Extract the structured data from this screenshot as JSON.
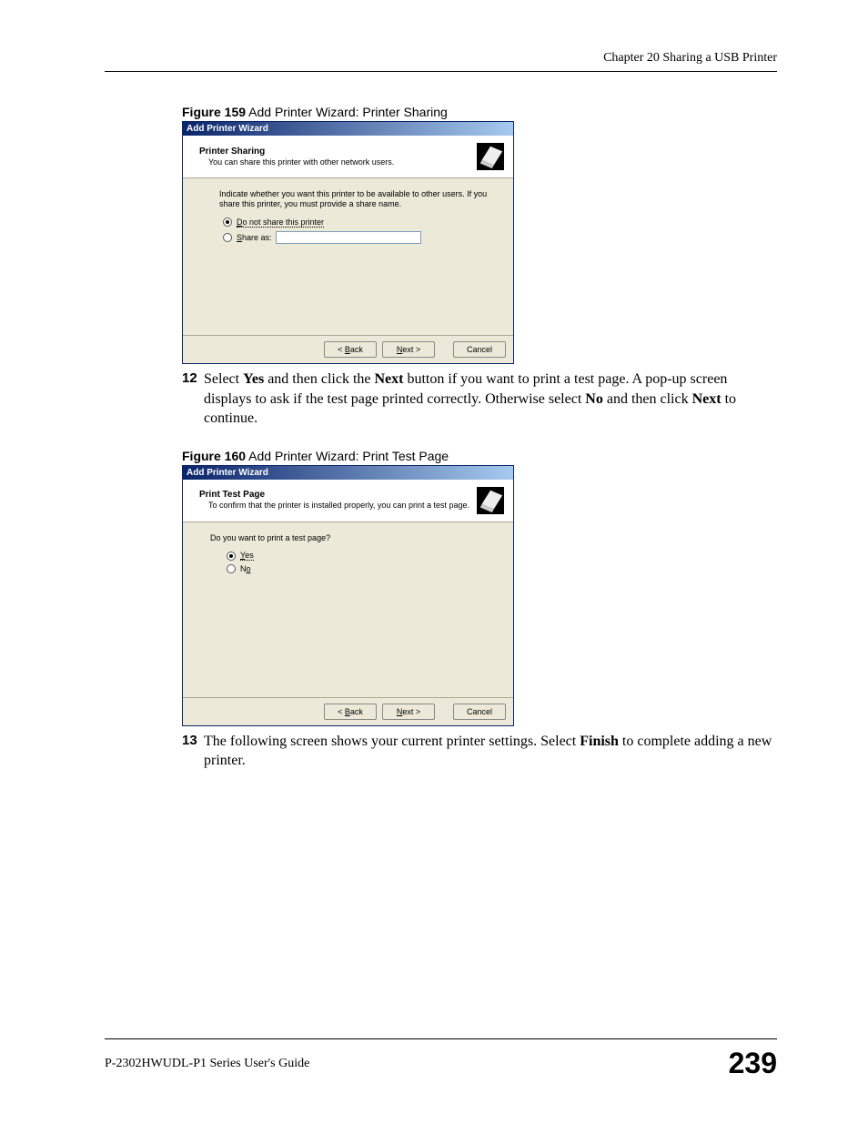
{
  "header": {
    "chapter": "Chapter 20 Sharing a USB Printer"
  },
  "figure159": {
    "caption_bold": "Figure 159",
    "caption_rest": "   Add Printer Wizard: Printer Sharing",
    "window_title": "Add Printer Wizard",
    "panel_title": "Printer Sharing",
    "panel_subtitle": "You can share this printer with other network users.",
    "instruction": "Indicate whether you want this printer to be available to other users. If you share this printer, you must provide a share name.",
    "radio1": "Do not share this printer",
    "radio2": "Share as:",
    "btn_back": "< Back",
    "btn_next": "Next >",
    "btn_cancel": "Cancel"
  },
  "step12": {
    "num": "12",
    "text_pre": "Select ",
    "yes": "Yes",
    "text_mid1": " and then click the ",
    "next": "Next",
    "text_mid2": " button if you want to print a test page. A pop-up screen displays to ask if the test page printed correctly. Otherwise select ",
    "no": "No",
    "text_mid3": " and then click ",
    "next2": "Next",
    "text_end": " to continue."
  },
  "figure160": {
    "caption_bold": "Figure 160",
    "caption_rest": "   Add Printer Wizard: Print Test Page",
    "window_title": "Add Printer Wizard",
    "panel_title": "Print Test Page",
    "panel_subtitle": "To confirm that the printer is installed properly, you can print a test page.",
    "question": "Do you want to print a test page?",
    "radio_yes": "Yes",
    "radio_no": "No",
    "btn_back": "< Back",
    "btn_next": "Next >",
    "btn_cancel": "Cancel"
  },
  "step13": {
    "num": "13",
    "text_pre": "The following screen shows your current printer settings. Select ",
    "finish": "Finish",
    "text_end": " to complete adding a new printer."
  },
  "footer": {
    "guide": "P-2302HWUDL-P1 Series User's Guide",
    "page": "239"
  }
}
